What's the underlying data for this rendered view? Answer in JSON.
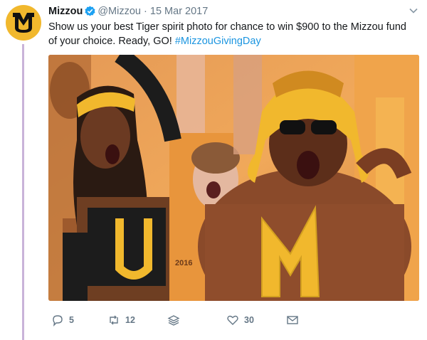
{
  "tweet": {
    "author_name": "Mizzou",
    "handle": "@Mizzou",
    "separator": "·",
    "date": "15 Mar 2017",
    "text": "Show us your best Tiger spirit photo for chance to win $900 to the Mizzou fund of your choice. Ready, GO! ",
    "hashtag": "#MizzouGivingDay",
    "photo_jersey_text": "2016"
  },
  "icons": {
    "avatar": "mizzou-mu-logo",
    "verified": "verified-badge-icon",
    "menu": "chevron-down-icon",
    "reply": "reply-icon",
    "retweet": "retweet-icon",
    "layers": "layers-icon",
    "like": "heart-icon",
    "message": "envelope-icon"
  },
  "actions": {
    "reply_count": "5",
    "retweet_count": "12",
    "like_count": "30"
  },
  "colors": {
    "link": "#1b95e0",
    "muted": "#657786",
    "brand_gold": "#f1b82d",
    "thread_line": "#c9b3d9"
  }
}
